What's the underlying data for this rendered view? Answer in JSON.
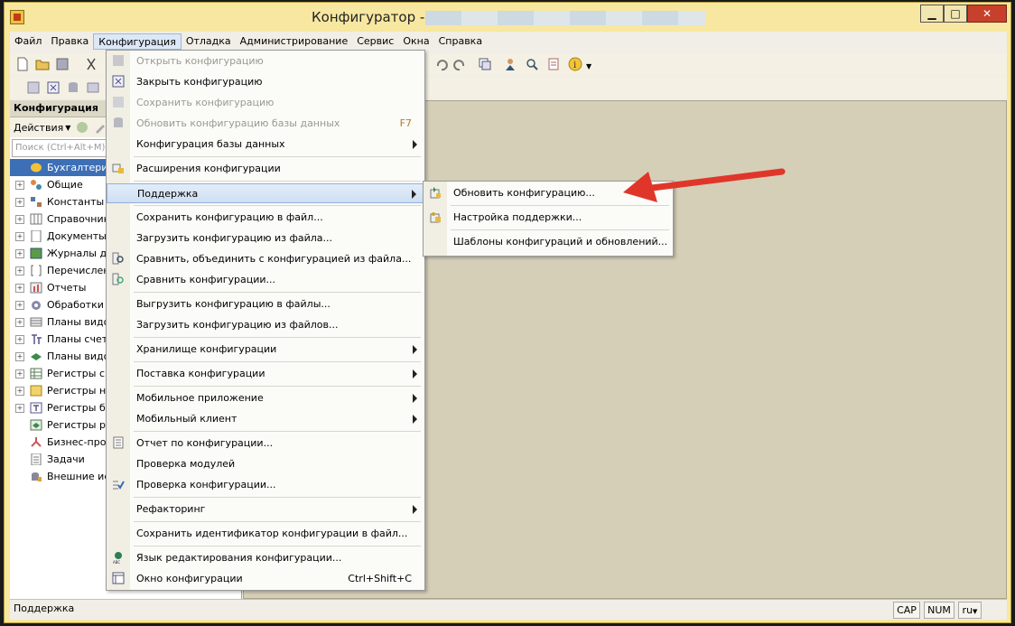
{
  "window": {
    "title": "Конфигуратор - "
  },
  "titlebar_buttons": {
    "minimize": "▁",
    "maximize": "□",
    "close": "✕"
  },
  "menubar": [
    {
      "label": "Файл"
    },
    {
      "label": "Правка"
    },
    {
      "label": "Конфигурация"
    },
    {
      "label": "Отладка"
    },
    {
      "label": "Администрирование"
    },
    {
      "label": "Сервис"
    },
    {
      "label": "Окна"
    },
    {
      "label": "Справка"
    }
  ],
  "left_panel": {
    "header": "Конфигурация",
    "actions_label": "Действия",
    "search_placeholder": "Поиск (Ctrl+Alt+M)",
    "tree": [
      {
        "label": "БухгалтерияПр"
      },
      {
        "label": "Общие"
      },
      {
        "label": "Константы"
      },
      {
        "label": "Справочник"
      },
      {
        "label": "Документы"
      },
      {
        "label": "Журналы до"
      },
      {
        "label": "Перечислен"
      },
      {
        "label": "Отчеты"
      },
      {
        "label": "Обработки"
      },
      {
        "label": "Планы видо"
      },
      {
        "label": "Планы счет"
      },
      {
        "label": "Планы видо"
      },
      {
        "label": "Регистры св"
      },
      {
        "label": "Регистры на"
      },
      {
        "label": "Регистры бу"
      },
      {
        "label": "Регистры ра"
      },
      {
        "label": "Бизнес-проц"
      },
      {
        "label": "Задачи"
      },
      {
        "label": "Внешние ис"
      }
    ]
  },
  "config_menu": {
    "items": [
      {
        "label": "Открыть конфигурацию",
        "disabled": true
      },
      {
        "label": "Закрыть конфигурацию"
      },
      {
        "label": "Сохранить конфигурацию",
        "disabled": true
      },
      {
        "label": "Обновить конфигурацию базы данных",
        "shortcut": "F7",
        "disabled": true
      },
      {
        "label": "Конфигурация базы данных"
      },
      {
        "label": "Расширения конфигурации"
      },
      {
        "label": "Поддержка"
      },
      {
        "label": "Сохранить конфигурацию в файл..."
      },
      {
        "label": "Загрузить конфигурацию из файла..."
      },
      {
        "label": "Сравнить, объединить с конфигурацией из файла..."
      },
      {
        "label": "Сравнить конфигурации..."
      },
      {
        "label": "Выгрузить конфигурацию в файлы..."
      },
      {
        "label": "Загрузить конфигурацию из файлов..."
      },
      {
        "label": "Хранилище конфигурации"
      },
      {
        "label": "Поставка конфигурации"
      },
      {
        "label": "Мобильное приложение"
      },
      {
        "label": "Мобильный клиент"
      },
      {
        "label": "Отчет по конфигурации..."
      },
      {
        "label": "Проверка модулей"
      },
      {
        "label": "Проверка конфигурации..."
      },
      {
        "label": "Рефакторинг"
      },
      {
        "label": "Сохранить идентификатор конфигурации в файл..."
      },
      {
        "label": "Язык редактирования конфигурации..."
      },
      {
        "label": "Окно конфигурации",
        "shortcut": "Ctrl+Shift+C"
      }
    ]
  },
  "support_submenu": {
    "items": [
      {
        "label": "Обновить конфигурацию..."
      },
      {
        "label": "Настройка поддержки..."
      },
      {
        "label": "Шаблоны конфигураций и обновлений..."
      }
    ]
  },
  "statusbar": {
    "text": "Поддержка",
    "cap": "CAP",
    "num": "NUM",
    "lang": "ru"
  },
  "colors": {
    "window_frame": "#f7e7a0",
    "highlight": "#cfdef2",
    "annotation_arrow": "#e0362a"
  }
}
